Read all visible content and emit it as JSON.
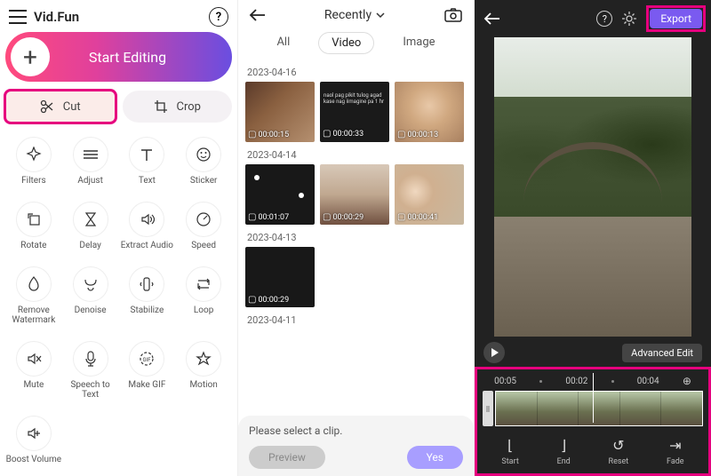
{
  "panel1": {
    "app_title": "Vid.Fun",
    "start_editing": "Start Editing",
    "cut": "Cut",
    "crop": "Crop",
    "tools": [
      {
        "label": "Filters",
        "icon": "filters"
      },
      {
        "label": "Adjust",
        "icon": "adjust"
      },
      {
        "label": "Text",
        "icon": "text"
      },
      {
        "label": "Sticker",
        "icon": "sticker"
      },
      {
        "label": "Rotate",
        "icon": "rotate"
      },
      {
        "label": "Delay",
        "icon": "delay"
      },
      {
        "label": "Extract Audio",
        "icon": "extract-audio"
      },
      {
        "label": "Speed",
        "icon": "speed"
      },
      {
        "label": "Remove Watermark",
        "icon": "watermark"
      },
      {
        "label": "Denoise",
        "icon": "denoise"
      },
      {
        "label": "Stabilize",
        "icon": "stabilize"
      },
      {
        "label": "Loop",
        "icon": "loop"
      },
      {
        "label": "Mute",
        "icon": "mute"
      },
      {
        "label": "Speech to Text",
        "icon": "speech"
      },
      {
        "label": "Make GIF",
        "icon": "gif"
      },
      {
        "label": "Motion",
        "icon": "motion"
      },
      {
        "label": "Boost Volume",
        "icon": "boost"
      }
    ]
  },
  "panel2": {
    "sort_label": "Recently",
    "tabs": {
      "all": "All",
      "video": "Video",
      "image": "Image"
    },
    "active_tab": "Video",
    "groups": [
      {
        "date": "2023-04-16",
        "items": [
          {
            "duration": "00:00:15"
          },
          {
            "duration": "00:00:33"
          },
          {
            "duration": "00:00:13"
          }
        ]
      },
      {
        "date": "2023-04-14",
        "items": [
          {
            "duration": "00:01:07"
          },
          {
            "duration": "00:00:29"
          },
          {
            "duration": "00:00:41"
          }
        ]
      },
      {
        "date": "2023-04-13",
        "items": [
          {
            "duration": "00:00:29"
          }
        ]
      },
      {
        "date": "2023-04-11",
        "items": []
      }
    ],
    "footer_msg": "Please select a clip.",
    "preview_btn": "Preview",
    "yes_btn": "Yes"
  },
  "panel3": {
    "export": "Export",
    "advanced_edit": "Advanced Edit",
    "times": {
      "t1": "00:05",
      "t2": "00:02",
      "t3": "00:04"
    },
    "controls": [
      {
        "label": "Start",
        "icon": "bracket-left"
      },
      {
        "label": "End",
        "icon": "bracket-right"
      },
      {
        "label": "Reset",
        "icon": "reset"
      },
      {
        "label": "Fade",
        "icon": "fade"
      }
    ]
  }
}
